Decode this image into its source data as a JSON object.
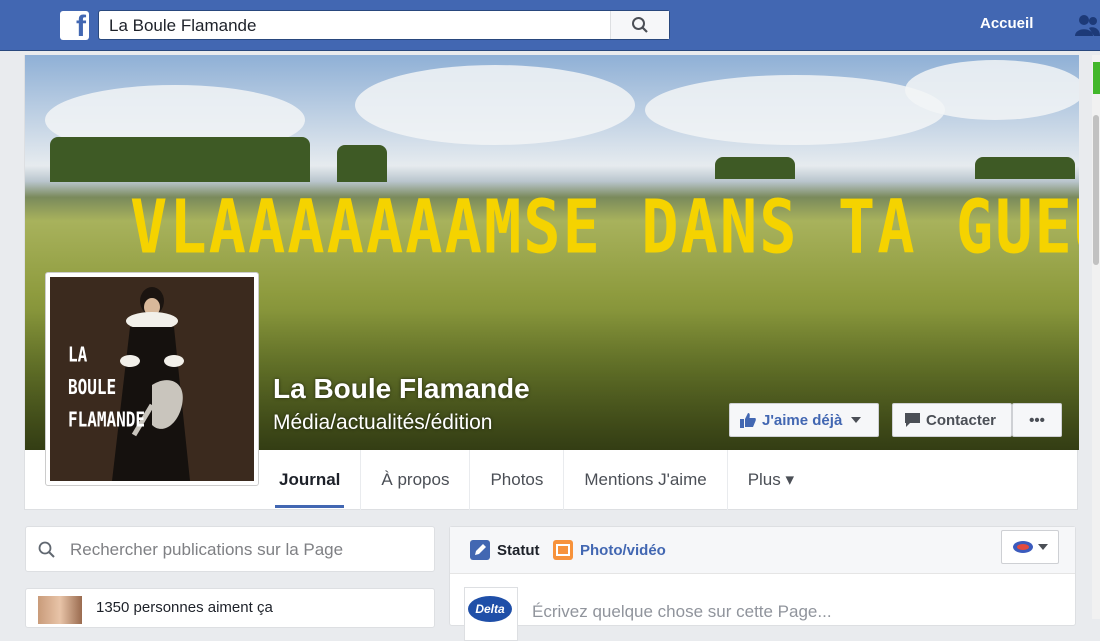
{
  "topbar": {
    "logo": "f",
    "search_value": "La Boule Flamande",
    "nav_home": "Accueil"
  },
  "cover": {
    "headline": "VLAAAAAAAMSE DANS TA GUEULE !",
    "headline_color": "#f5d300"
  },
  "profile": {
    "logo_line1": "LA",
    "logo_line2": "BOULE",
    "logo_line3": "FLAMANDE"
  },
  "page": {
    "name": "La Boule Flamande",
    "category": "Média/actualités/édition"
  },
  "actions": {
    "like_label": "J'aime déjà",
    "contact_label": "Contacter",
    "more_label": "•••"
  },
  "tabs": [
    {
      "label": "Journal",
      "active": true
    },
    {
      "label": "À propos"
    },
    {
      "label": "Photos"
    },
    {
      "label": "Mentions J'aime"
    },
    {
      "label": "Plus ▾"
    }
  ],
  "sidebar": {
    "search_placeholder": "Rechercher publications sur la Page",
    "likes_text": "1350 personnes aiment ça"
  },
  "composer": {
    "tab_status": "Statut",
    "tab_photo": "Photo/vidéo",
    "placeholder": "Écrivez quelque chose sur cette Page...",
    "avatar_text": "Delta"
  },
  "colors": {
    "brand": "#4267b2",
    "background": "#e9ebee"
  }
}
